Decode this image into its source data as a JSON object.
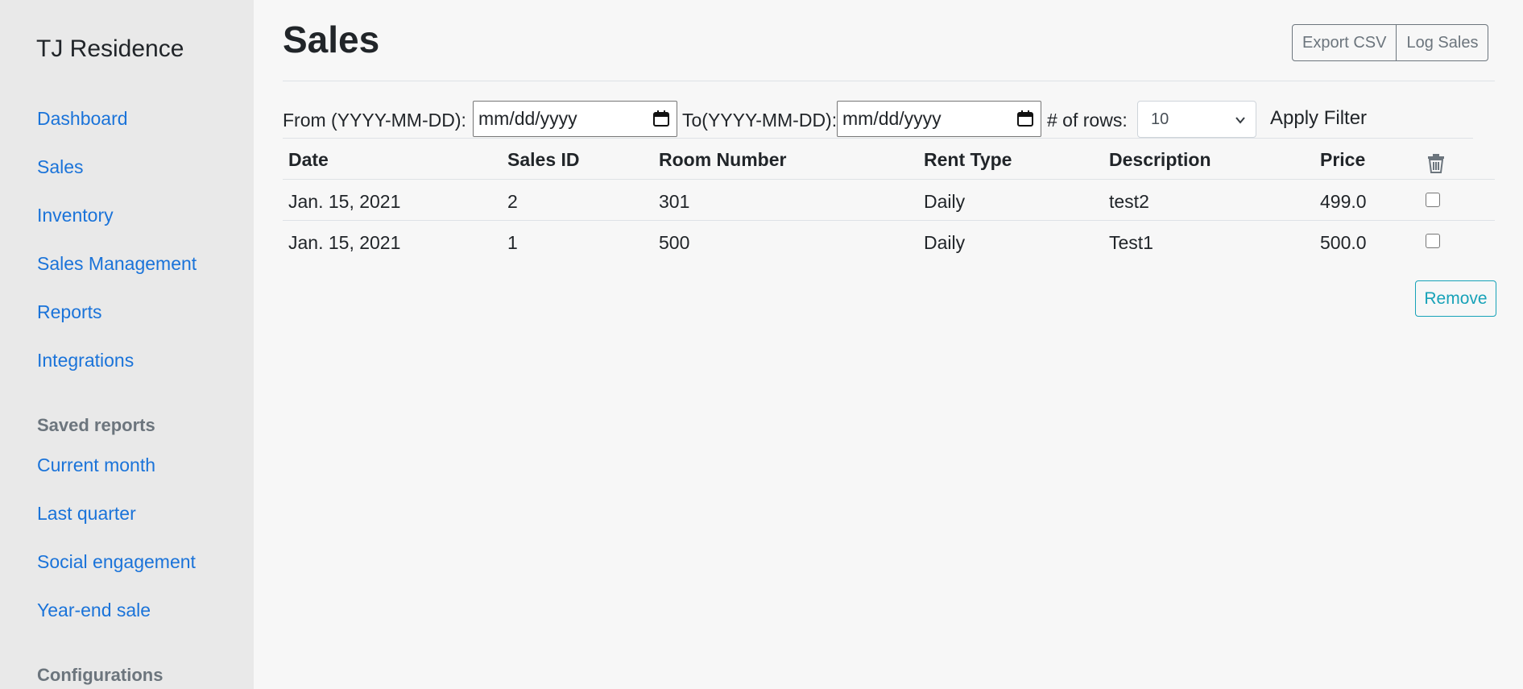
{
  "sidebar": {
    "brand": "TJ Residence",
    "nav": [
      {
        "label": "Dashboard"
      },
      {
        "label": "Sales"
      },
      {
        "label": "Inventory"
      },
      {
        "label": "Sales Management"
      },
      {
        "label": "Reports"
      },
      {
        "label": "Integrations"
      }
    ],
    "saved_reports_heading": "Saved reports",
    "saved_reports": [
      {
        "label": "Current month"
      },
      {
        "label": "Last quarter"
      },
      {
        "label": "Social engagement"
      },
      {
        "label": "Year-end sale"
      }
    ],
    "configurations_heading": "Configurations"
  },
  "main": {
    "title": "Sales",
    "export_label": "Export CSV",
    "log_label": "Log Sales",
    "filter": {
      "from_label": "From (YYYY-MM-DD):",
      "from_placeholder": "mm/dd/yyyy",
      "to_label": "To(YYYY-MM-DD):",
      "to_placeholder": "mm/dd/yyyy",
      "rows_label": "# of rows:",
      "rows_value": "10",
      "apply_label": "Apply Filter"
    },
    "table": {
      "headers": [
        "Date",
        "Sales ID",
        "Room Number",
        "Rent Type",
        "Description",
        "Price"
      ],
      "rows": [
        [
          "Jan. 15, 2021",
          "2",
          "301",
          "Daily",
          "test2",
          "499.0"
        ],
        [
          "Jan. 15, 2021",
          "1",
          "500",
          "Daily",
          "Test1",
          "500.0"
        ]
      ]
    },
    "remove_label": "Remove"
  },
  "colors": {
    "link": "#1a73d9",
    "sidebar_bg": "#e9e9e9",
    "remove_accent": "#17a2b8"
  },
  "icons": {
    "delete_column": "trash-icon",
    "date_picker": "calendar-icon",
    "select": "chevron-down-icon"
  }
}
